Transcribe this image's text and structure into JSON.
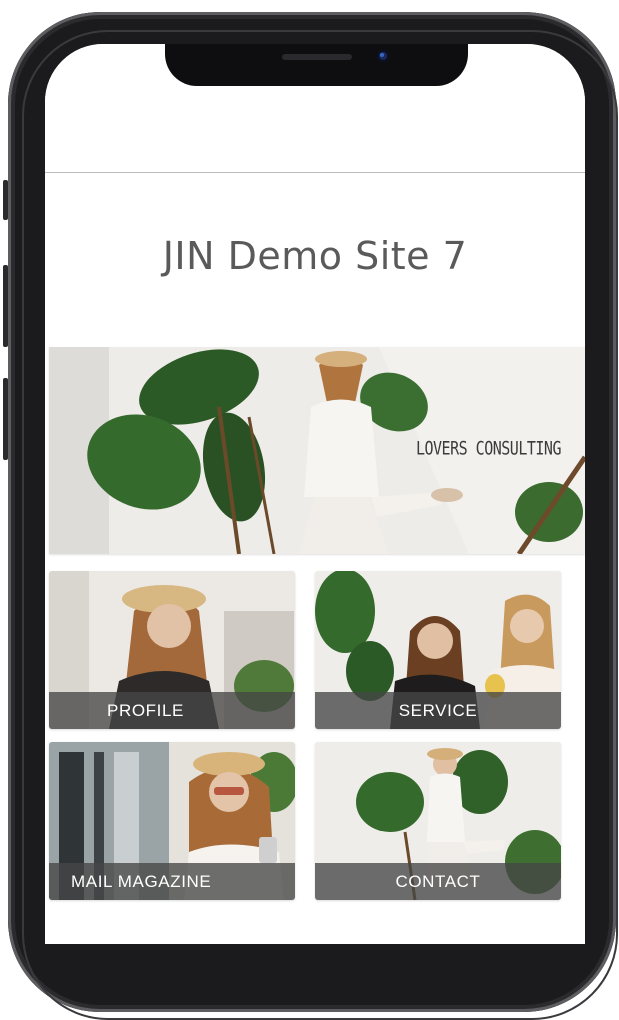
{
  "site": {
    "title": "JIN Demo Site 7"
  },
  "hero": {
    "text": "LOVERS CONSULTING"
  },
  "tiles": [
    {
      "label": "PROFILE"
    },
    {
      "label": "SERVICE"
    },
    {
      "label": "MAIL MAGAZINE"
    },
    {
      "label": "CONTACT"
    }
  ],
  "colors": {
    "title": "#5a5a5a",
    "tile_label_bg": "#464646",
    "frame": "#1b1b1d",
    "foliage": "#2f5d2a"
  },
  "icons": {
    "camera": "front-camera-icon"
  }
}
